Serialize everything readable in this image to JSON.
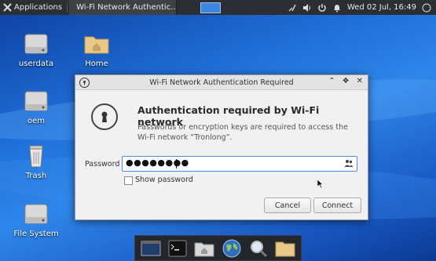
{
  "panel": {
    "applications_label": "Applications",
    "task_title": "Wi-Fi Network Authentic...",
    "clock": "Wed 02 Jul, 16:49"
  },
  "desktop": {
    "icons": [
      {
        "label": "userdata",
        "icon": "drive-icon"
      },
      {
        "label": "Home",
        "icon": "folder-home-icon"
      },
      {
        "label": "oem",
        "icon": "drive-icon"
      },
      {
        "label": "Trash",
        "icon": "trash-icon"
      },
      {
        "label": "File System",
        "icon": "drive-icon"
      }
    ]
  },
  "dialog": {
    "title": "Wi-Fi Network Authentication Required",
    "heading": "Authentication required by Wi-Fi network",
    "description": "Passwords or encryption keys are required to access the Wi-Fi network “Tronlong”.",
    "password_label": "Password",
    "password_masked": "●●●●●●●●",
    "show_password_label": "Show password",
    "show_password_checked": false,
    "cancel_label": "Cancel",
    "connect_label": "Connect"
  },
  "dock": {
    "items": [
      "desktop-icon",
      "terminal-icon",
      "file-manager-icon",
      "web-browser-icon",
      "search-icon",
      "folder-icon"
    ]
  }
}
